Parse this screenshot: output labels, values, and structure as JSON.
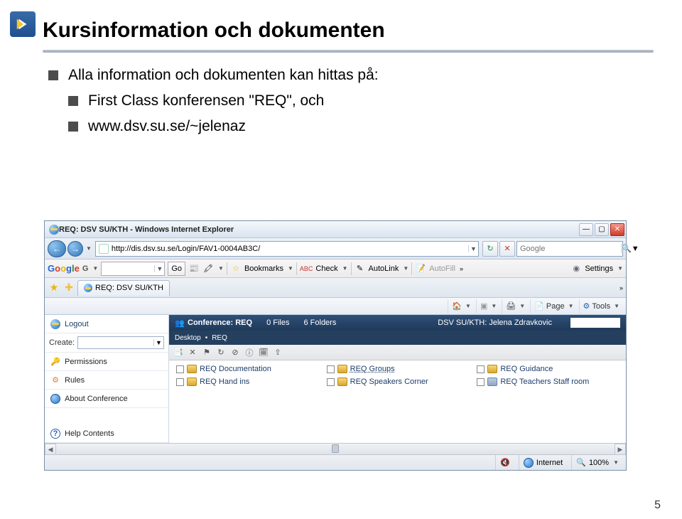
{
  "slide": {
    "title": "Kursinformation och dokumenten",
    "bullet1": "Alla information och dokumenten kan hittas på:",
    "sub1": "First Class konferensen \"REQ\", och",
    "sub2": "www.dsv.su.se/~jelenaz",
    "pagenum": "5"
  },
  "browser": {
    "window_title": "REQ: DSV SU/KTH - Windows Internet Explorer",
    "url": "http://dis.dsv.su.se/Login/FAV1-0004AB3C/",
    "search_placeholder": "Google",
    "google_go": "Go",
    "google_bookmarks": "Bookmarks",
    "google_check": "Check",
    "google_autolink": "AutoLink",
    "google_autofill": "AutoFill",
    "google_settings": "Settings",
    "tab_title": "REQ: DSV SU/KTH",
    "tool_page": "Page",
    "tool_tools": "Tools",
    "conf_label": "Conference: REQ",
    "conf_files": "0 Files",
    "conf_folders": "6 Folders",
    "conf_user": "DSV SU/KTH: Jelena Zdravkovic",
    "conf_sub1": "Desktop",
    "conf_sub2": "REQ",
    "left": {
      "logout": "Logout",
      "create": "Create:",
      "permissions": "Permissions",
      "rules": "Rules",
      "about": "About Conference",
      "help": "Help Contents"
    },
    "folders": {
      "f1": "REQ Documentation",
      "f2": "REQ Groups",
      "f3": "REQ Guidance",
      "f4": "REQ Hand ins",
      "f5": "REQ Speakers Corner",
      "f6": "REQ Teachers Staff room"
    },
    "status_internet": "Internet",
    "status_zoom": "100%"
  }
}
